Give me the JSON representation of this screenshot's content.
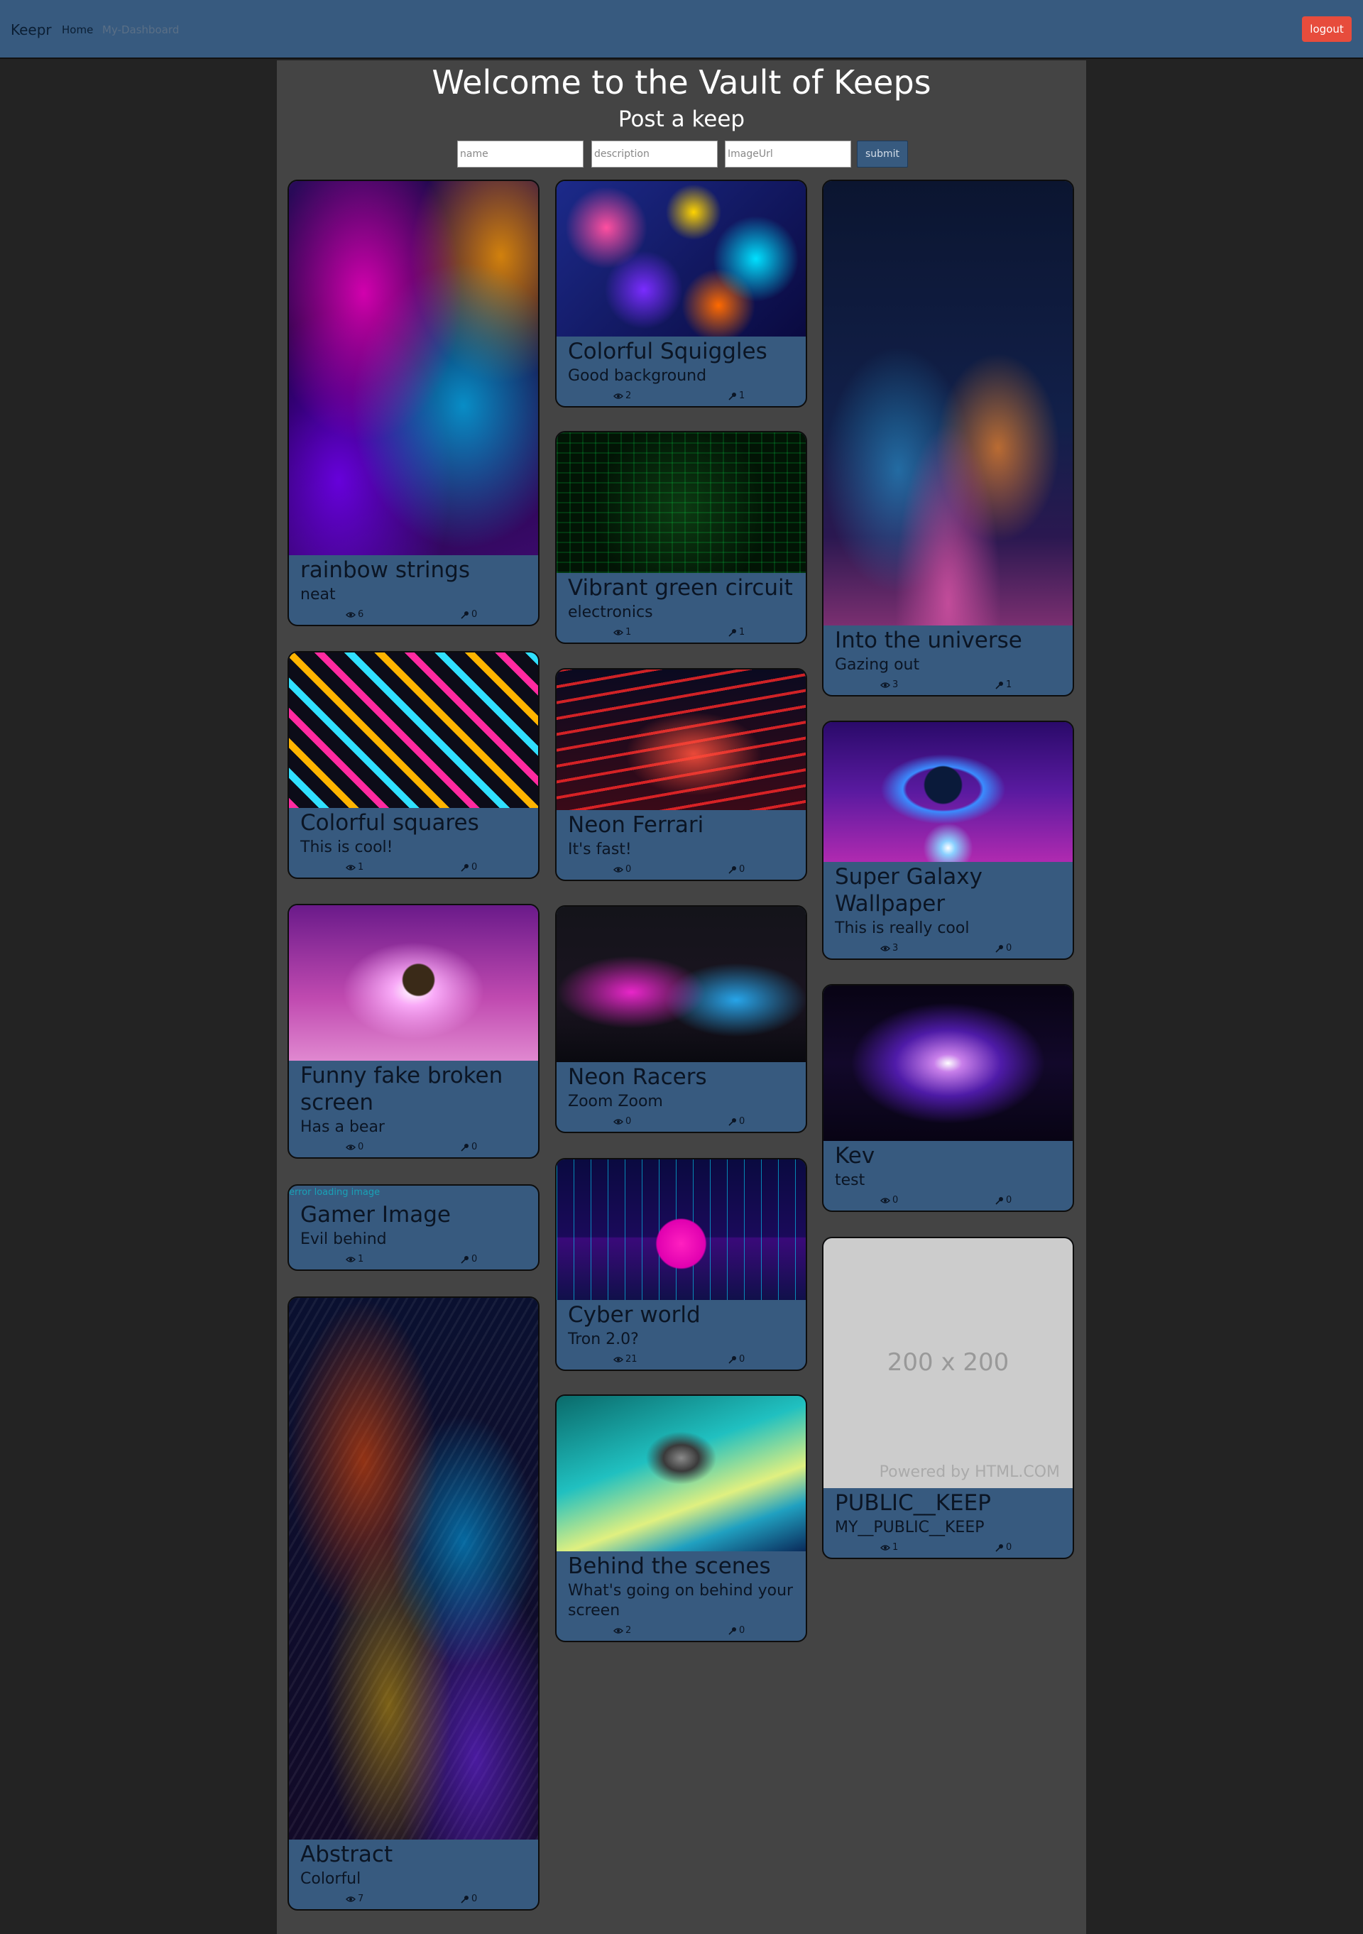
{
  "nav": {
    "brand": "Keepr",
    "home": "Home",
    "dashboard": "My-Dashboard",
    "logout": "logout"
  },
  "header": {
    "title": "Welcome to the Vault of Keeps",
    "subtitle": "Post a keep"
  },
  "form": {
    "name_placeholder": "name",
    "description_placeholder": "description",
    "image_placeholder": "ImageUrl",
    "submit_label": "submit"
  },
  "broken_image_text": "error loading image",
  "placeholder_image": {
    "size_text": "200 x 200",
    "powered_text": "Powered by HTML.COM"
  },
  "keeps": [
    {
      "name": "rainbow strings",
      "description": "neat",
      "views": "6",
      "keeps": "0"
    },
    {
      "name": "Colorful Squiggles",
      "description": "Good background",
      "views": "2",
      "keeps": "1"
    },
    {
      "name": "Into the universe",
      "description": "Gazing out",
      "views": "3",
      "keeps": "1"
    },
    {
      "name": "Vibrant green circuit",
      "description": "electronics",
      "views": "1",
      "keeps": "1"
    },
    {
      "name": "Colorful squares",
      "description": "This is cool!",
      "views": "1",
      "keeps": "0"
    },
    {
      "name": "Neon Ferrari",
      "description": "It's fast!",
      "views": "0",
      "keeps": "0"
    },
    {
      "name": "Super Galaxy Wallpaper",
      "description": "This is really cool",
      "views": "3",
      "keeps": "0"
    },
    {
      "name": "Funny fake broken screen",
      "description": "Has a bear",
      "views": "0",
      "keeps": "0"
    },
    {
      "name": "Neon Racers",
      "description": "Zoom Zoom",
      "views": "0",
      "keeps": "0"
    },
    {
      "name": "Kev",
      "description": "test",
      "views": "0",
      "keeps": "0"
    },
    {
      "name": "Gamer Image",
      "description": "Evil behind",
      "views": "1",
      "keeps": "0"
    },
    {
      "name": "Cyber world",
      "description": "Tron 2.0?",
      "views": "21",
      "keeps": "0"
    },
    {
      "name": "PUBLIC__KEEP",
      "description": "MY__PUBLIC__KEEP",
      "views": "1",
      "keeps": "0"
    },
    {
      "name": "Abstract",
      "description": "Colorful",
      "views": "7",
      "keeps": "0"
    },
    {
      "name": "Behind the scenes",
      "description": "What's going on behind your screen",
      "views": "2",
      "keeps": "0"
    }
  ],
  "icons": {
    "views": "eye-icon",
    "keeps": "key-icon"
  }
}
